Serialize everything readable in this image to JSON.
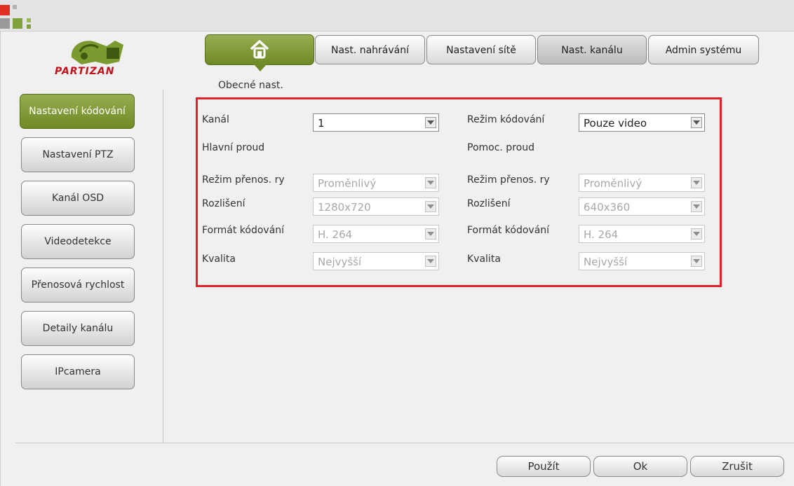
{
  "brand": "PARTIZAN",
  "tabs": {
    "home_subtitle": "Obecné nast.",
    "items": [
      {
        "label": "Nast. nahrávání"
      },
      {
        "label": "Nastavení sítě"
      },
      {
        "label": "Nast. kanálu"
      },
      {
        "label": "Admin systému"
      }
    ]
  },
  "sidebar": {
    "items": [
      {
        "label": "Nastavení kódování"
      },
      {
        "label": "Nastavení PTZ"
      },
      {
        "label": "Kanál OSD"
      },
      {
        "label": "Videodetekce"
      },
      {
        "label": "Přenosová rychlost"
      },
      {
        "label": "Detaily kanálu"
      },
      {
        "label": "IPcamera"
      }
    ]
  },
  "form": {
    "channel_label": "Kanál",
    "channel_value": "1",
    "encoding_mode_label": "Režim kódování",
    "encoding_mode_value": "Pouze video",
    "main_stream_label": "Hlavní proud",
    "sub_stream_label": "Pomoc. proud",
    "main": {
      "bitrate_mode_label": "Režim přenos. ry",
      "bitrate_mode_value": "Proměnlivý",
      "resolution_label": "Rozlišení",
      "resolution_value": "1280x720",
      "codec_label": "Formát kódování",
      "codec_value": "H. 264",
      "quality_label": "Kvalita",
      "quality_value": "Nejvyšší"
    },
    "sub": {
      "bitrate_mode_label": "Režim přenos. ry",
      "bitrate_mode_value": "Proměnlivý",
      "resolution_label": "Rozlišení",
      "resolution_value": "640x360",
      "codec_label": "Formát kódování",
      "codec_value": "H. 264",
      "quality_label": "Kvalita",
      "quality_value": "Nejvyšší"
    }
  },
  "footer": {
    "apply_label": "Použít",
    "ok_label": "Ok",
    "cancel_label": "Zrušit"
  },
  "colors": {
    "accent_green": "#7f9934",
    "highlight_red": "#e3212b",
    "brand_red": "#c0121a"
  }
}
